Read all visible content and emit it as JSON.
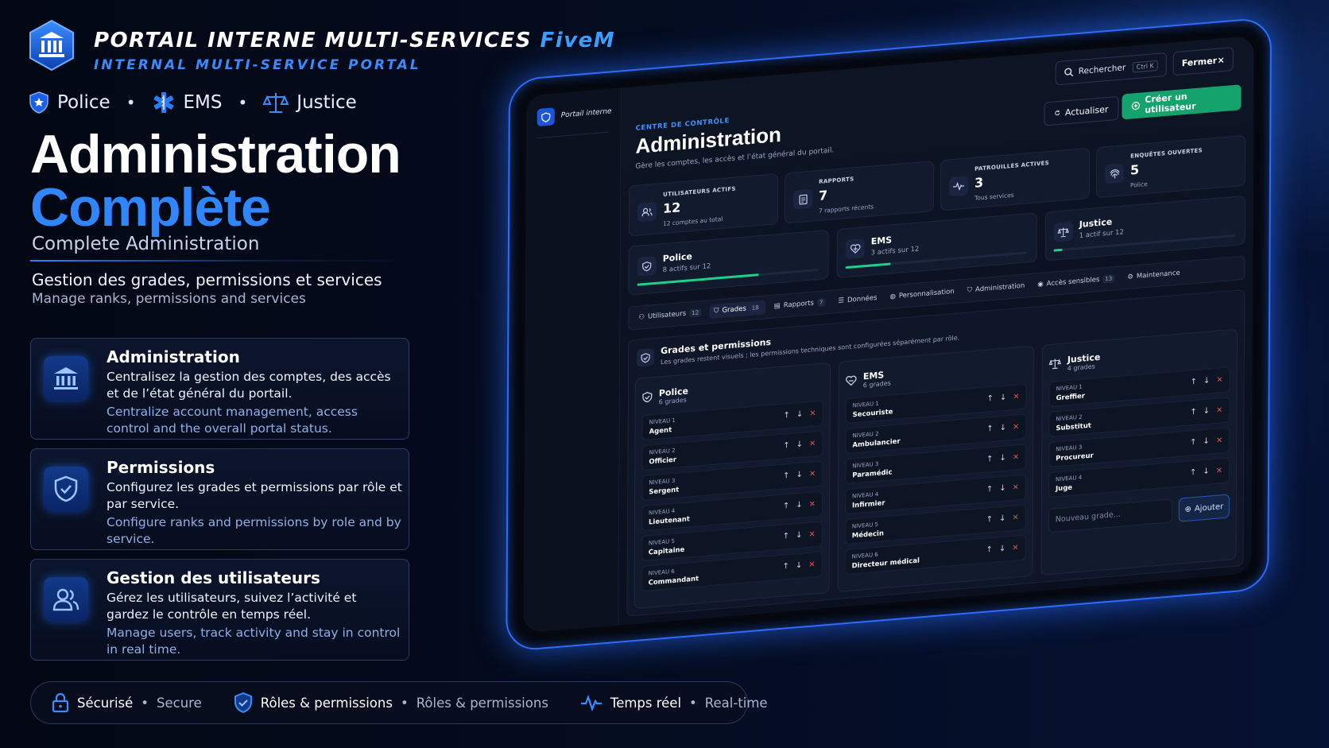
{
  "header": {
    "title": "PORTAIL INTERNE MULTI-SERVICES",
    "title_accent": "FiveM",
    "subtitle": "INTERNAL MULTI-SERVICE PORTAL",
    "services": [
      "Police",
      "EMS",
      "Justice"
    ],
    "separator": "•"
  },
  "hero": {
    "line1": "Administration",
    "line2": "Complète",
    "english": "Complete Administration",
    "desc_fr": "Gestion des grades, permissions et services",
    "desc_en": "Manage ranks, permissions and services"
  },
  "features": [
    {
      "icon": "bank-icon",
      "title": "Administration",
      "fr": "Centralisez la gestion des comptes, des accès et de l’état général du portail.",
      "en": "Centralize account management, access control and the overall portal status."
    },
    {
      "icon": "shield-check-icon",
      "title": "Permissions",
      "fr": "Configurez les grades et permissions par rôle et par service.",
      "en": "Configure ranks and permissions by role and by service."
    },
    {
      "icon": "users-icon",
      "title": "Gestion des utilisateurs",
      "fr": "Gérez les utilisateurs, suivez l’activité et gardez le contrôle en temps réel.",
      "en": "Manage users, track activity and stay in control in real time."
    }
  ],
  "footer": [
    {
      "icon": "lock-icon",
      "fr": "Sécurisé",
      "en": "Secure"
    },
    {
      "icon": "shield-icon",
      "fr": "Rôles & permissions",
      "en": "Rôles & permissions"
    },
    {
      "icon": "pulse-icon",
      "fr": "Temps réel",
      "en": "Real-time"
    }
  ],
  "app": {
    "brand": "Portail interne",
    "search_label": "Rechercher",
    "search_kbd": "Ctrl K",
    "close_label": "Fermer",
    "kicker": "CENTRE DE CONTRÔLE",
    "title": "Administration",
    "lead": "Gère les comptes, les accès et l’état général du portail.",
    "refresh_label": "Actualiser",
    "create_label": "Créer un utilisateur",
    "stats": [
      {
        "label": "UTILISATEURS ACTIFS",
        "value": "12",
        "sub": "12 comptes au total"
      },
      {
        "label": "RAPPORTS",
        "value": "7",
        "sub": "7 rapports récents"
      },
      {
        "label": "PATROUILLES ACTIVES",
        "value": "3",
        "sub": "Tous services"
      },
      {
        "label": "ENQUÊTES OUVERTES",
        "value": "5",
        "sub": "Police"
      }
    ],
    "services": [
      {
        "name": "Police",
        "count": "8 actifs sur 12",
        "fill": 0.67
      },
      {
        "name": "EMS",
        "count": "3 actifs sur 12",
        "fill": 0.25
      },
      {
        "name": "Justice",
        "count": "1 actif sur 12",
        "fill": 0.05
      }
    ],
    "tabs": [
      {
        "label": "Utilisateurs",
        "count": "12"
      },
      {
        "label": "Grades",
        "count": "18"
      },
      {
        "label": "Rapports",
        "count": "7"
      },
      {
        "label": "Données",
        "count": ""
      },
      {
        "label": "Personnalisation",
        "count": ""
      },
      {
        "label": "Administration",
        "count": ""
      },
      {
        "label": "Accès sensibles",
        "count": "13"
      },
      {
        "label": "Maintenance",
        "count": ""
      }
    ],
    "grades_title": "Grades et permissions",
    "grades_sub": "Les grades restent visuels ; les permissions techniques sont configurées séparément par rôle.",
    "columns": [
      {
        "name": "Police",
        "count": "6 grades",
        "ranks": [
          {
            "lvl": "NIVEAU 1",
            "name": "Agent"
          },
          {
            "lvl": "NIVEAU 2",
            "name": "Officier"
          },
          {
            "lvl": "NIVEAU 3",
            "name": "Sergent"
          },
          {
            "lvl": "NIVEAU 4",
            "name": "Lieutenant"
          },
          {
            "lvl": "NIVEAU 5",
            "name": "Capitaine"
          },
          {
            "lvl": "NIVEAU 6",
            "name": "Commandant"
          }
        ]
      },
      {
        "name": "EMS",
        "count": "6 grades",
        "ranks": [
          {
            "lvl": "NIVEAU 1",
            "name": "Secouriste"
          },
          {
            "lvl": "NIVEAU 2",
            "name": "Ambulancier"
          },
          {
            "lvl": "NIVEAU 3",
            "name": "Paramédic"
          },
          {
            "lvl": "NIVEAU 4",
            "name": "Infirmier"
          },
          {
            "lvl": "NIVEAU 5",
            "name": "Médecin"
          },
          {
            "lvl": "NIVEAU 6",
            "name": "Directeur médical"
          }
        ]
      },
      {
        "name": "Justice",
        "count": "4 grades",
        "ranks": [
          {
            "lvl": "NIVEAU 1",
            "name": "Greffier"
          },
          {
            "lvl": "NIVEAU 2",
            "name": "Substitut"
          },
          {
            "lvl": "NIVEAU 3",
            "name": "Procureur"
          },
          {
            "lvl": "NIVEAU 4",
            "name": "Juge"
          }
        ]
      }
    ],
    "new_grade_placeholder": "Nouveau grade...",
    "add_label": "Ajouter",
    "rank_up": "↑",
    "rank_down": "↓",
    "rank_delete": "×",
    "colors": {
      "accent": "#2f86ff",
      "create": "#14a36c",
      "bar": "#1fd08a",
      "danger": "#ff5a5a"
    }
  }
}
